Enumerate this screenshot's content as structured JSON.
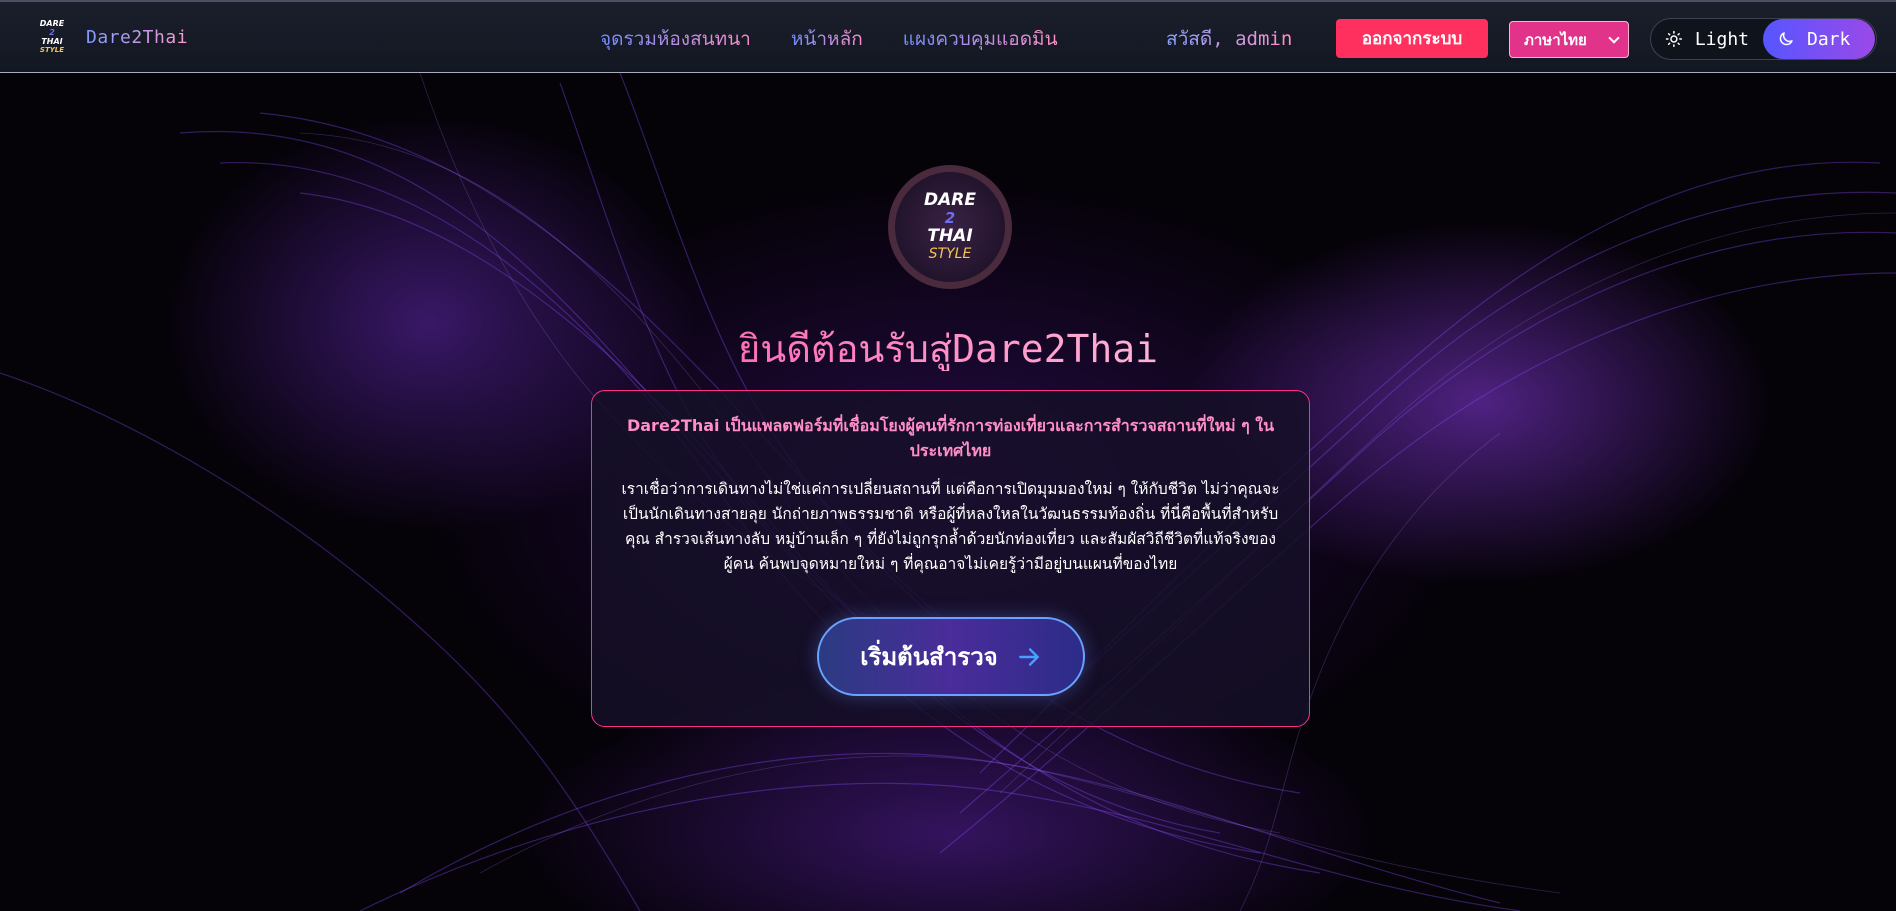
{
  "navbar": {
    "brand": {
      "logo_lines": [
        "DARE",
        "2",
        "THAI",
        "STYLE"
      ],
      "name": "Dare2Thai"
    },
    "links": [
      {
        "label": "จุดรวมห้องสนทนา"
      },
      {
        "label": "หน้าหลัก"
      },
      {
        "label": "แผงควบคุมแอดมิน"
      }
    ],
    "greeting": "สวัสดี, admin",
    "logout_label": "ออกจากระบบ",
    "language": {
      "selected": "ภาษาไทย"
    },
    "theme": {
      "light_label": "Light",
      "dark_label": "Dark",
      "active": "dark"
    }
  },
  "hero": {
    "emblem_lines": [
      "DARE",
      "2",
      "THAI",
      "STYLE"
    ],
    "title": "ยินดีต้อนรับสู่Dare2Thai",
    "lead": "Dare2Thai เป็นแพลตฟอร์มที่เชื่อมโยงผู้คนที่รักการท่องเที่ยวและการสำรวจสถานที่ใหม่ ๆ ในประเทศไทย",
    "body": "เราเชื่อว่าการเดินทางไม่ใช่แค่การเปลี่ยนสถานที่ แต่คือการเปิดมุมมองใหม่ ๆ ให้กับชีวิต ไม่ว่าคุณจะเป็นนักเดินทางสายลุย นักถ่ายภาพธรรมชาติ หรือผู้ที่หลงใหลในวัฒนธรรมท้องถิ่น ที่นี่คือพื้นที่สำหรับคุณ สำรวจเส้นทางลับ หมู่บ้านเล็ก ๆ ที่ยังไม่ถูกรุกล้ำด้วยนักท่องเที่ยว และสัมผัสวิถีชีวิตที่แท้จริงของผู้คน ค้นพบจุดหมายใหม่ ๆ ที่คุณอาจไม่เคยรู้ว่ามีอยู่บนแผนที่ของไทย",
    "cta_label": "เริ่มต้นสำรวจ"
  },
  "colors": {
    "accent_pink": "#ff2e86",
    "logout_red": "#ff2f5e",
    "dark_toggle": "#5656ff",
    "background": "#000000"
  },
  "icons": {
    "theme_light": "sun-icon",
    "theme_dark": "moon-icon",
    "cta": "arrow-right-icon",
    "language": "chevron-down-icon"
  }
}
